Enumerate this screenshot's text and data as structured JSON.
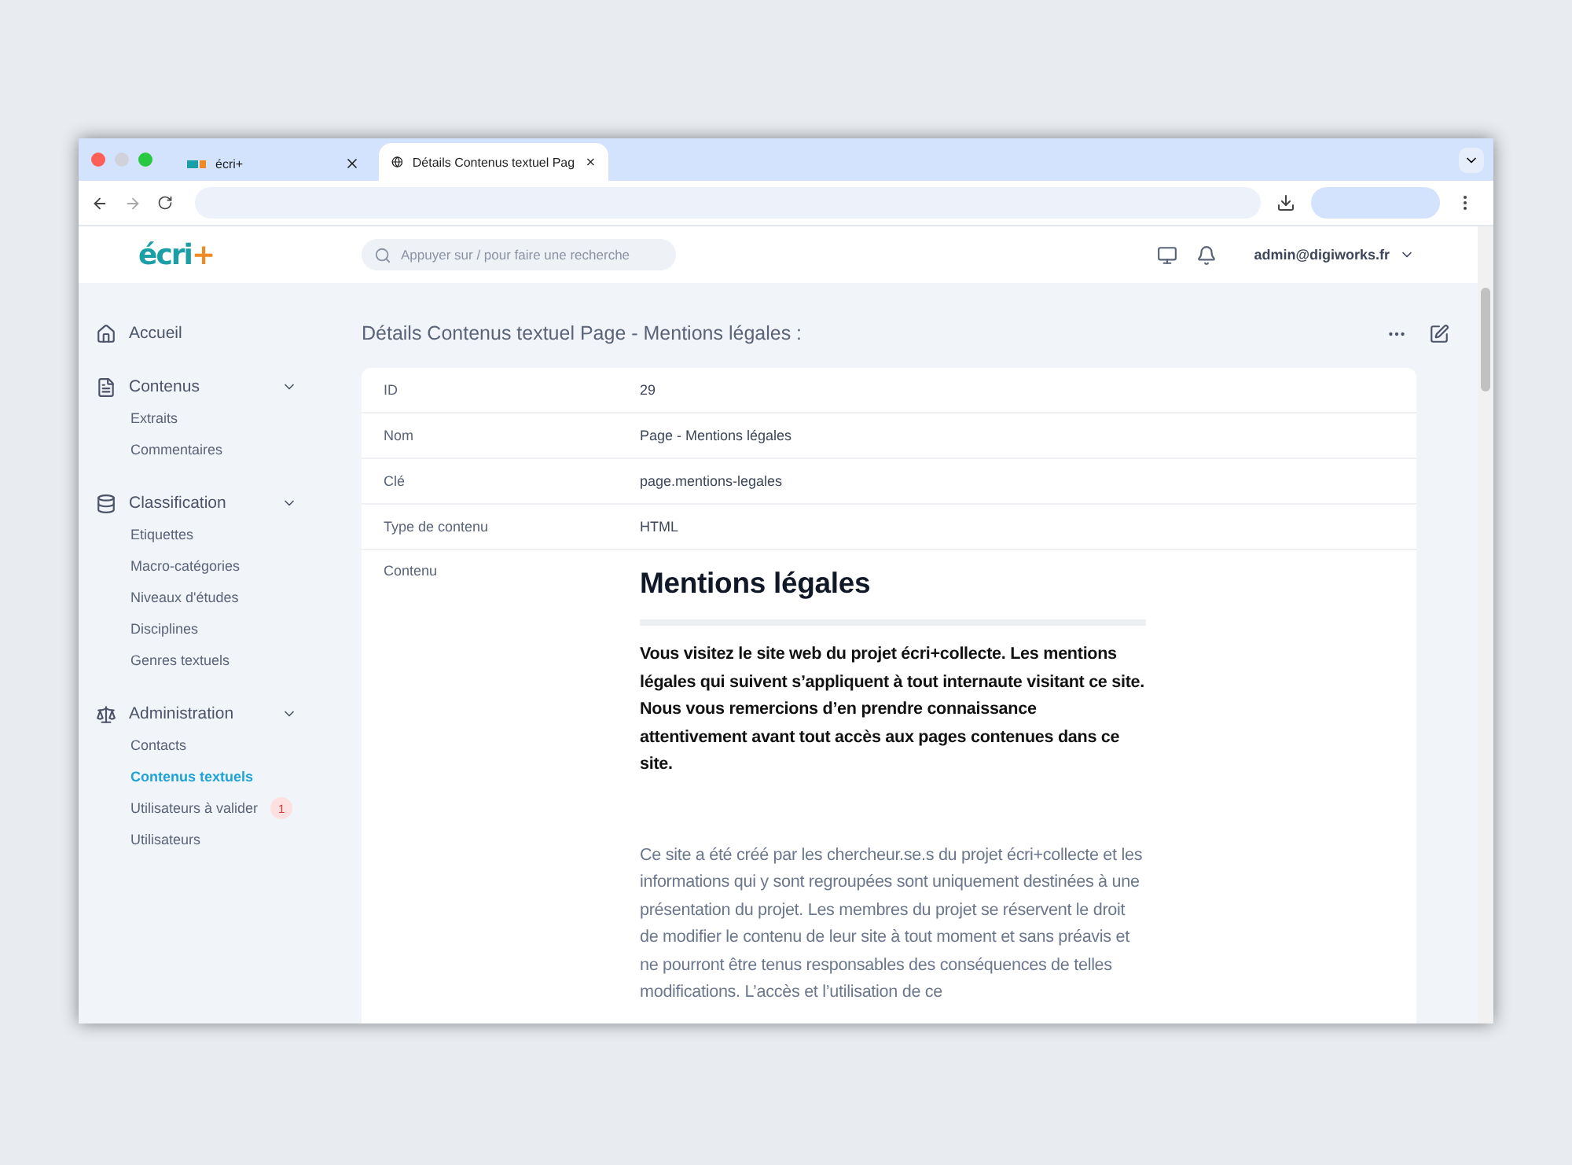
{
  "browser": {
    "tabs": [
      {
        "title": "écri+",
        "selected": false
      },
      {
        "title": "Détails Contenus textuel Pag",
        "selected": true
      }
    ]
  },
  "header": {
    "logo": {
      "word": "écri",
      "mark": "+"
    },
    "search": {
      "placeholder": "Appuyer sur / pour faire une recherche"
    },
    "user": "admin@digiworks.fr"
  },
  "sidebar": {
    "sections": [
      {
        "label": "Accueil"
      },
      {
        "label": "Contenus",
        "expanded": true,
        "items": [
          {
            "label": "Extraits",
            "selected": false
          },
          {
            "label": "Commentaires",
            "selected": false
          }
        ]
      },
      {
        "label": "Classification",
        "expanded": true,
        "items": [
          {
            "label": "Etiquettes",
            "selected": false
          },
          {
            "label": "Macro-catégories",
            "selected": false
          },
          {
            "label": "Niveaux d'études",
            "selected": false
          },
          {
            "label": "Disciplines",
            "selected": false
          },
          {
            "label": "Genres textuels",
            "selected": false
          }
        ]
      },
      {
        "label": "Administration",
        "expanded": true,
        "items": [
          {
            "label": "Contacts",
            "selected": false
          },
          {
            "label": "Contenus textuels",
            "selected": true
          },
          {
            "label": "Utilisateurs à valider",
            "selected": false,
            "badge": "1"
          },
          {
            "label": "Utilisateurs",
            "selected": false
          }
        ]
      }
    ]
  },
  "page": {
    "title": "Détails Contenus textuel Page - Mentions légales :",
    "fields": [
      {
        "label": "ID",
        "value": "29"
      },
      {
        "label": "Nom",
        "value": "Page - Mentions légales"
      },
      {
        "label": "Clé",
        "value": "page.mentions-legales"
      },
      {
        "label": "Type de contenu",
        "value": "HTML"
      }
    ],
    "content": {
      "label": "Contenu",
      "heading": "Mentions légales",
      "intro": "Vous visitez le site web du projet écri+collecte. Les mentions légales qui suivent s’appliquent à tout internaute visitant ce site. Nous vous remercions d’en prendre connaissance attentivement avant tout accès aux pages contenues dans ce site.",
      "body": "Ce site a été créé par les chercheur.se.s du projet écri+collecte et les informations qui y sont regroupées sont uniquement destinées à une présentation du projet. Les membres du projet se réservent le droit de modifier le contenu de leur site à tout moment et sans préavis et ne pourront être tenus responsables des conséquences de telles modifications. L’accès et l’utilisation de ce"
    }
  }
}
